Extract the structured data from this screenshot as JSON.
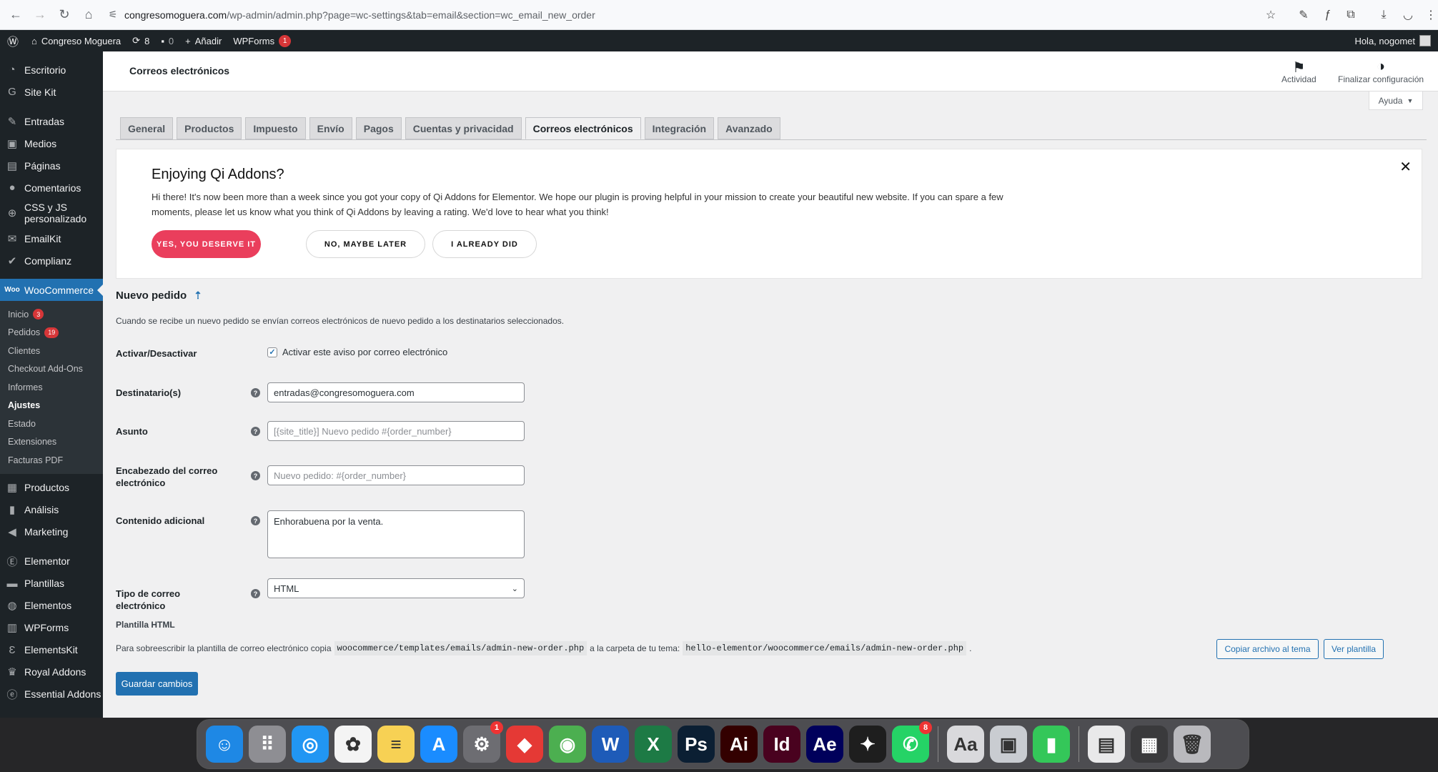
{
  "browser": {
    "url_host": "congresomoguera.com",
    "url_path": "/wp-admin/admin.php?page=wc-settings&tab=email&section=wc_email_new_order"
  },
  "adminbar": {
    "site_name": "Congreso Moguera",
    "updates_count": "8",
    "comments_count": "0",
    "add_label": "Añadir",
    "wpforms_label": "WPForms",
    "wpforms_badge": "1",
    "greeting": "Hola, nogomet"
  },
  "sidebar": {
    "items_top": [
      {
        "label": "Escritorio",
        "icon": "dashboard-icon"
      },
      {
        "label": "Site Kit",
        "icon": "google-g-icon"
      }
    ],
    "items_content": [
      {
        "label": "Entradas",
        "icon": "pin-icon"
      },
      {
        "label": "Medios",
        "icon": "media-icon"
      },
      {
        "label": "Páginas",
        "icon": "pages-icon"
      },
      {
        "label": "Comentarios",
        "icon": "comment-icon"
      },
      {
        "label": "CSS y JS personalizado",
        "icon": "plus-circle-icon"
      },
      {
        "label": "EmailKit",
        "icon": "mail-icon"
      },
      {
        "label": "Complianz",
        "icon": "check-icon"
      }
    ],
    "woo_label": "WooCommerce",
    "woo_sub": [
      {
        "label": "Inicio",
        "badge": "3"
      },
      {
        "label": "Pedidos",
        "badge": "19"
      },
      {
        "label": "Clientes",
        "badge": ""
      },
      {
        "label": "Checkout Add-Ons",
        "badge": ""
      },
      {
        "label": "Informes",
        "badge": ""
      },
      {
        "label": "Ajustes",
        "badge": ""
      },
      {
        "label": "Estado",
        "badge": ""
      },
      {
        "label": "Extensiones",
        "badge": ""
      },
      {
        "label": "Facturas PDF",
        "badge": ""
      }
    ],
    "items_bottom": [
      {
        "label": "Productos",
        "icon": "archive-icon"
      },
      {
        "label": "Análisis",
        "icon": "bar-chart-icon"
      },
      {
        "label": "Marketing",
        "icon": "megaphone-icon"
      }
    ],
    "items_plugins": [
      {
        "label": "Elementor",
        "icon": "elementor-icon"
      },
      {
        "label": "Plantillas",
        "icon": "folder-icon"
      },
      {
        "label": "Elementos",
        "icon": "elements-icon"
      },
      {
        "label": "WPForms",
        "icon": "form-icon"
      },
      {
        "label": "ElementsKit",
        "icon": "ek-icon"
      },
      {
        "label": "Royal Addons",
        "icon": "crown-icon"
      },
      {
        "label": "Essential Addons",
        "icon": "ea-icon"
      }
    ]
  },
  "header": {
    "title": "Correos electrónicos",
    "activity_label": "Actividad",
    "finish_setup_label": "Finalizar configuración",
    "help_label": "Ayuda"
  },
  "tabs": [
    "General",
    "Productos",
    "Impuesto",
    "Envío",
    "Pagos",
    "Cuentas y privacidad",
    "Correos electrónicos",
    "Integración",
    "Avanzado"
  ],
  "active_tab": "Correos electrónicos",
  "notice": {
    "title": "Enjoying Qi Addons?",
    "body": "Hi there! It's now been more than a week since you got your copy of Qi Addons for Elementor. We hope our plugin is proving helpful in your mission to create your beautiful new website. If you can spare a few moments, please let us know what you think of Qi Addons by leaving a rating. We'd love to hear what you think!",
    "btn_yes": "YES, YOU DESERVE IT",
    "btn_maybe": "NO, MAYBE LATER",
    "btn_did": "I ALREADY DID"
  },
  "section": {
    "title": "Nuevo pedido",
    "description": "Cuando se recibe un nuevo pedido se envían correos electrónicos de nuevo pedido a los destinatarios seleccionados."
  },
  "fields": {
    "enable_label": "Activar/Desactivar",
    "enable_checkbox": "Activar este aviso por correo electrónico",
    "recipient_label": "Destinatario(s)",
    "recipient_value": "entradas@congresomoguera.com",
    "subject_label": "Asunto",
    "subject_placeholder": "[{site_title}] Nuevo pedido #{order_number}",
    "heading_label": "Encabezado del correo electrónico",
    "heading_placeholder": "Nuevo pedido: #{order_number}",
    "additional_label": "Contenido adicional",
    "additional_value": "Enhorabuena por la venta.",
    "type_label": "Tipo de correo electrónico",
    "type_value": "HTML"
  },
  "template": {
    "title": "Plantilla HTML",
    "text_1": "Para sobreescribir la plantilla de correo electrónico copia",
    "code_1": "woocommerce/templates/emails/admin-new-order.php",
    "text_2": "a la carpeta de tu tema:",
    "code_2": "hello-elementor/woocommerce/emails/admin-new-order.php",
    "text_3": ".",
    "copy_btn": "Copiar archivo al tema",
    "view_btn": "Ver plantilla"
  },
  "save_label": "Guardar cambios",
  "dock": {
    "apps": [
      {
        "name": "finder-icon",
        "glyph": "☺",
        "color": "#1e88e5"
      },
      {
        "name": "launchpad-icon",
        "glyph": "⠿",
        "color": "#8e8e93"
      },
      {
        "name": "safari-icon",
        "glyph": "◎",
        "color": "#2196f3"
      },
      {
        "name": "photos-icon",
        "glyph": "✿",
        "color": "#f4f4f4"
      },
      {
        "name": "notes-icon",
        "glyph": "≡",
        "color": "#f7d154"
      },
      {
        "name": "app-store-icon",
        "glyph": "A",
        "color": "#1a8cff"
      },
      {
        "name": "system-settings-icon",
        "glyph": "⚙",
        "color": "#6d6d72",
        "badge": "1"
      },
      {
        "name": "anydesk-icon",
        "glyph": "◆",
        "color": "#e53935"
      },
      {
        "name": "chrome-icon",
        "glyph": "◉",
        "color": "#4caf50"
      },
      {
        "name": "word-icon",
        "glyph": "W",
        "color": "#1e5bb8"
      },
      {
        "name": "excel-icon",
        "glyph": "X",
        "color": "#1d7a45"
      },
      {
        "name": "photoshop-icon",
        "glyph": "Ps",
        "color": "#0b1f33"
      },
      {
        "name": "illustrator-icon",
        "glyph": "Ai",
        "color": "#330000"
      },
      {
        "name": "indesign-icon",
        "glyph": "Id",
        "color": "#49021f"
      },
      {
        "name": "after-effects-icon",
        "glyph": "Ae",
        "color": "#00005b"
      },
      {
        "name": "figma-icon",
        "glyph": "✦",
        "color": "#1e1e1e"
      },
      {
        "name": "whatsapp-icon",
        "glyph": "✆",
        "color": "#25d366",
        "badge": "8"
      }
    ],
    "apps_right": [
      {
        "name": "font-book-icon",
        "glyph": "Aa",
        "color": "#d9d9dc"
      },
      {
        "name": "preview-icon",
        "glyph": "▣",
        "color": "#c9ccd1"
      },
      {
        "name": "numbers-icon",
        "glyph": "▮",
        "color": "#34c759"
      }
    ],
    "apps_recent": [
      {
        "name": "recent-document-icon",
        "glyph": "▤",
        "color": "#e9e9ea"
      },
      {
        "name": "recent-window-icon",
        "glyph": "▦",
        "color": "#3a3a3c"
      },
      {
        "name": "trash-icon",
        "glyph": "🗑",
        "color": "#b9b9bd"
      }
    ]
  }
}
